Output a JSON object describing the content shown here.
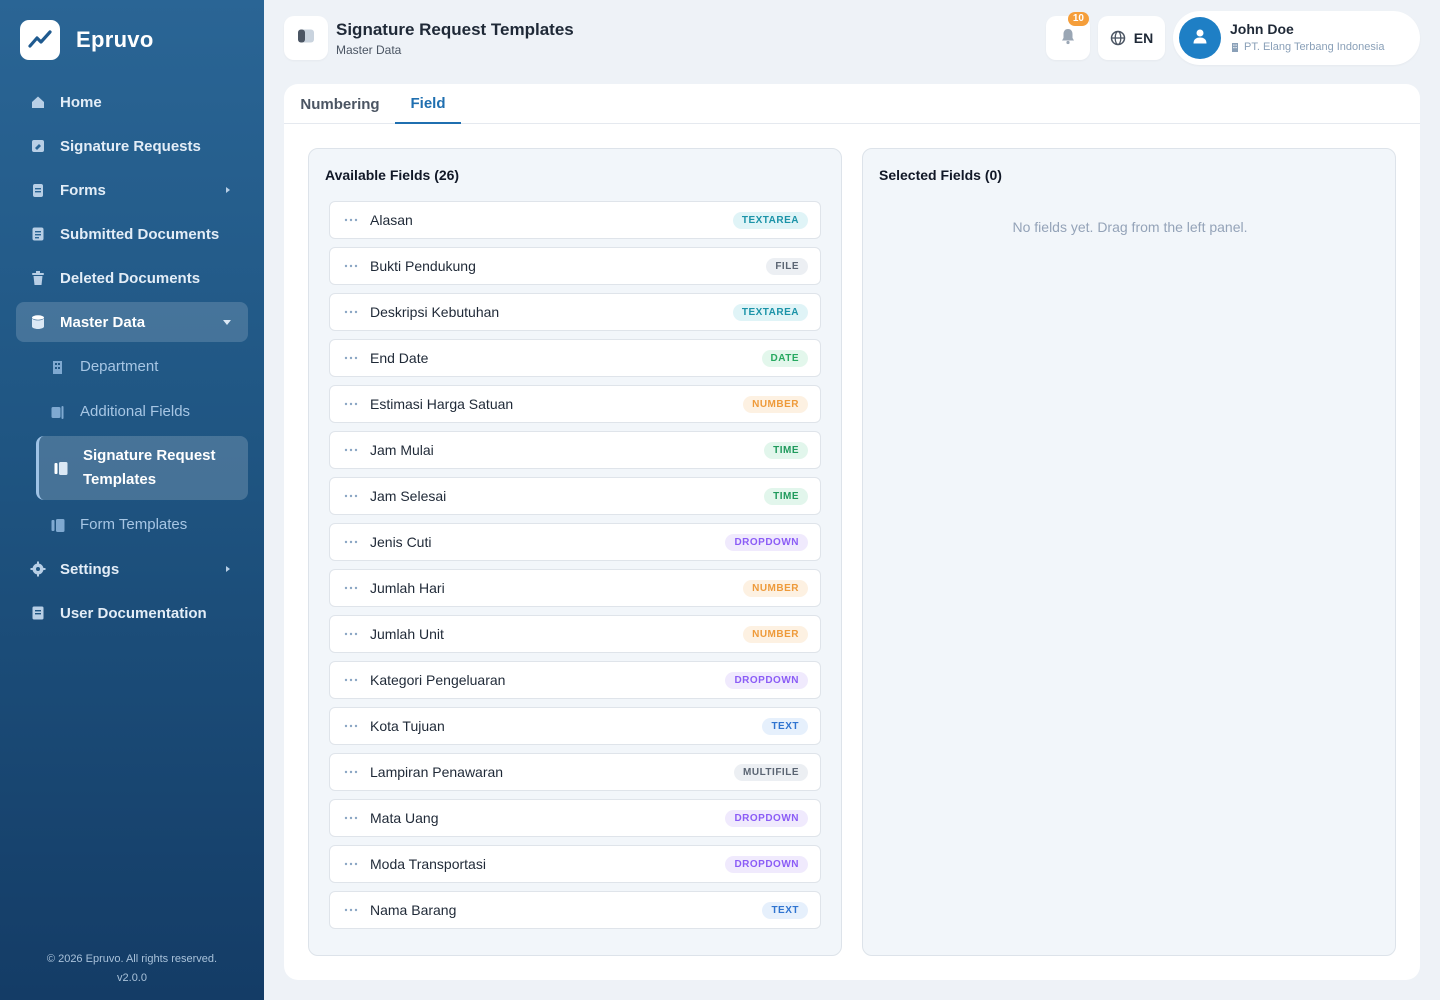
{
  "brand": {
    "name": "Epruvo"
  },
  "sidebar": {
    "items": [
      {
        "label": "Home",
        "icon": "home-icon"
      },
      {
        "label": "Signature Requests",
        "icon": "signature-icon"
      },
      {
        "label": "Forms",
        "icon": "clipboard-icon",
        "has_submenu": true
      },
      {
        "label": "Submitted Documents",
        "icon": "document-icon"
      },
      {
        "label": "Deleted Documents",
        "icon": "trash-icon"
      },
      {
        "label": "Master Data",
        "icon": "database-icon",
        "expanded": true
      }
    ],
    "master_data_items": [
      {
        "label": "Department",
        "icon": "building-icon"
      },
      {
        "label": "Additional Fields",
        "icon": "fields-icon"
      },
      {
        "label": "Signature Request Templates",
        "icon": "template-icon",
        "active": true
      },
      {
        "label": "Form Templates",
        "icon": "template-icon"
      }
    ],
    "bottom_items": [
      {
        "label": "Settings",
        "icon": "gear-icon",
        "has_submenu": true
      },
      {
        "label": "User Documentation",
        "icon": "book-icon"
      }
    ],
    "footer": {
      "copyright": "© 2026 Epruvo. All rights reserved.",
      "version": "v2.0.0"
    }
  },
  "header": {
    "title": "Signature Request Templates",
    "subtitle": "Master Data",
    "notification_count": "10",
    "language": "EN",
    "user": {
      "name": "John Doe",
      "organization": "PT. Elang Terbang Indonesia"
    }
  },
  "tabs": [
    {
      "label": "Numbering",
      "active": false
    },
    {
      "label": "Field",
      "active": true
    }
  ],
  "available_panel": {
    "title": "Available Fields (26)",
    "fields": [
      {
        "name": "Alasan",
        "type": "TEXTAREA"
      },
      {
        "name": "Bukti Pendukung",
        "type": "FILE"
      },
      {
        "name": "Deskripsi Kebutuhan",
        "type": "TEXTAREA"
      },
      {
        "name": "End Date",
        "type": "DATE"
      },
      {
        "name": "Estimasi Harga Satuan",
        "type": "NUMBER"
      },
      {
        "name": "Jam Mulai",
        "type": "TIME"
      },
      {
        "name": "Jam Selesai",
        "type": "TIME"
      },
      {
        "name": "Jenis Cuti",
        "type": "DROPDOWN"
      },
      {
        "name": "Jumlah Hari",
        "type": "NUMBER"
      },
      {
        "name": "Jumlah Unit",
        "type": "NUMBER"
      },
      {
        "name": "Kategori Pengeluaran",
        "type": "DROPDOWN"
      },
      {
        "name": "Kota Tujuan",
        "type": "TEXT"
      },
      {
        "name": "Lampiran Penawaran",
        "type": "MULTIFILE"
      },
      {
        "name": "Mata Uang",
        "type": "DROPDOWN"
      },
      {
        "name": "Moda Transportasi",
        "type": "DROPDOWN"
      },
      {
        "name": "Nama Barang",
        "type": "TEXT"
      }
    ]
  },
  "selected_panel": {
    "title": "Selected Fields (0)",
    "empty_message": "No fields yet. Drag from the left panel."
  },
  "type_colors": {
    "TEXTAREA": {
      "bg": "#e0f4f7",
      "fg": "#1b93a8"
    },
    "FILE": {
      "bg": "#eceff3",
      "fg": "#5b6573"
    },
    "MULTIFILE": {
      "bg": "#eceff3",
      "fg": "#5b6573"
    },
    "DATE": {
      "bg": "#e3f7ec",
      "fg": "#27a960"
    },
    "NUMBER": {
      "bg": "#fdf1e2",
      "fg": "#ee9a3a"
    },
    "TIME": {
      "bg": "#e2f6ec",
      "fg": "#1f9a5c"
    },
    "DROPDOWN": {
      "bg": "#f0eafd",
      "fg": "#8b5cf6"
    },
    "TEXT": {
      "bg": "#e6f0fc",
      "fg": "#2f74d0"
    }
  }
}
